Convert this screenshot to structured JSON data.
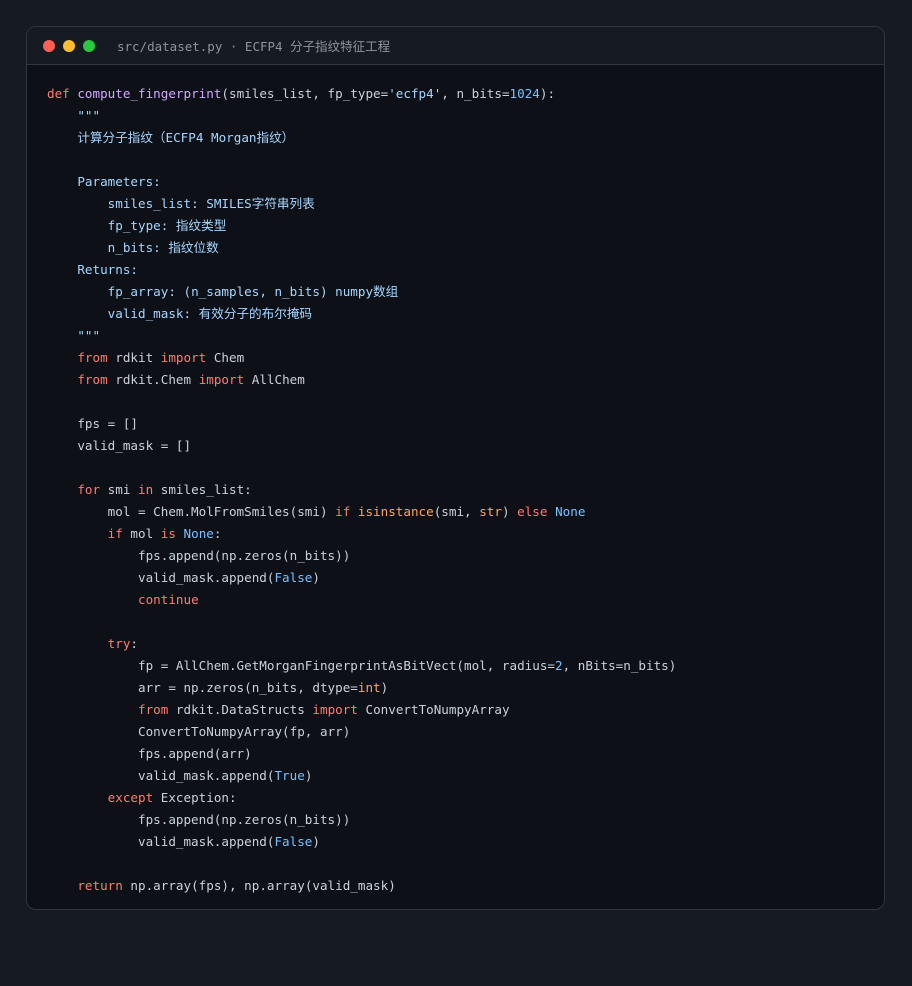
{
  "window": {
    "title": "src/dataset.py · ECFP4 分子指纹特征工程",
    "controls": [
      {
        "name": "close",
        "color": "#ff5f57"
      },
      {
        "name": "minimize",
        "color": "#febc2e"
      },
      {
        "name": "maximize",
        "color": "#28c840"
      }
    ]
  },
  "colors": {
    "keyword": "#ff7b72",
    "function": "#d2a8ff",
    "string": "#a5d6ff",
    "number": "#79c0ff",
    "builtin": "#ffa657",
    "text": "#c9d1d9",
    "background": "#0d1117"
  },
  "code": {
    "lines": [
      [
        [
          "kw",
          "def"
        ],
        [
          "t",
          " "
        ],
        [
          "fn",
          "compute_fingerprint"
        ],
        [
          "t",
          "(smiles_list, fp_type="
        ],
        [
          "str",
          "'ecfp4'"
        ],
        [
          "t",
          ", n_bits="
        ],
        [
          "num",
          "1024"
        ],
        [
          "t",
          "):"
        ]
      ],
      [
        [
          "t",
          "    "
        ],
        [
          "doc",
          "\"\"\""
        ]
      ],
      [
        [
          "t",
          "    "
        ],
        [
          "doc",
          "计算分子指纹（ECFP4 Morgan指纹）"
        ]
      ],
      [],
      [
        [
          "t",
          "    "
        ],
        [
          "doc",
          "Parameters:"
        ]
      ],
      [
        [
          "t",
          "        "
        ],
        [
          "doc",
          "smiles_list: SMILES字符串列表"
        ]
      ],
      [
        [
          "t",
          "        "
        ],
        [
          "doc",
          "fp_type: 指纹类型"
        ]
      ],
      [
        [
          "t",
          "        "
        ],
        [
          "doc",
          "n_bits: 指纹位数"
        ]
      ],
      [
        [
          "t",
          "    "
        ],
        [
          "doc",
          "Returns:"
        ]
      ],
      [
        [
          "t",
          "        "
        ],
        [
          "doc",
          "fp_array: (n_samples, n_bits) numpy数组"
        ]
      ],
      [
        [
          "t",
          "        "
        ],
        [
          "doc",
          "valid_mask: 有效分子的布尔掩码"
        ]
      ],
      [
        [
          "t",
          "    "
        ],
        [
          "doc",
          "\"\"\""
        ]
      ],
      [
        [
          "t",
          "    "
        ],
        [
          "kw",
          "from"
        ],
        [
          "t",
          " rdkit "
        ],
        [
          "kw",
          "import"
        ],
        [
          "t",
          " Chem"
        ]
      ],
      [
        [
          "t",
          "    "
        ],
        [
          "kw",
          "from"
        ],
        [
          "t",
          " rdkit.Chem "
        ],
        [
          "kw",
          "import"
        ],
        [
          "t",
          " AllChem"
        ]
      ],
      [],
      [
        [
          "t",
          "    fps = []"
        ]
      ],
      [
        [
          "t",
          "    valid_mask = []"
        ]
      ],
      [],
      [
        [
          "t",
          "    "
        ],
        [
          "kw",
          "for"
        ],
        [
          "t",
          " smi "
        ],
        [
          "kw",
          "in"
        ],
        [
          "t",
          " smiles_list:"
        ]
      ],
      [
        [
          "t",
          "        mol = Chem.MolFromSmiles(smi) "
        ],
        [
          "kw",
          "if"
        ],
        [
          "t",
          " "
        ],
        [
          "bi",
          "isinstance"
        ],
        [
          "t",
          "(smi, "
        ],
        [
          "bi",
          "str"
        ],
        [
          "t",
          ") "
        ],
        [
          "kw",
          "else"
        ],
        [
          "t",
          " "
        ],
        [
          "const",
          "None"
        ]
      ],
      [
        [
          "t",
          "        "
        ],
        [
          "kw",
          "if"
        ],
        [
          "t",
          " mol "
        ],
        [
          "kw",
          "is"
        ],
        [
          "t",
          " "
        ],
        [
          "const",
          "None"
        ],
        [
          "t",
          ":"
        ]
      ],
      [
        [
          "t",
          "            fps.append(np.zeros(n_bits))"
        ]
      ],
      [
        [
          "t",
          "            valid_mask.append("
        ],
        [
          "const",
          "False"
        ],
        [
          "t",
          ")"
        ]
      ],
      [
        [
          "t",
          "            "
        ],
        [
          "kw",
          "continue"
        ]
      ],
      [],
      [
        [
          "t",
          "        "
        ],
        [
          "kw",
          "try"
        ],
        [
          "t",
          ":"
        ]
      ],
      [
        [
          "t",
          "            fp = AllChem.GetMorganFingerprintAsBitVect(mol, radius="
        ],
        [
          "num",
          "2"
        ],
        [
          "t",
          ", nBits=n_bits)"
        ]
      ],
      [
        [
          "t",
          "            arr = np.zeros(n_bits, dtype="
        ],
        [
          "bi",
          "int"
        ],
        [
          "t",
          ")"
        ]
      ],
      [
        [
          "t",
          "            "
        ],
        [
          "kw",
          "from"
        ],
        [
          "t",
          " rdkit.DataStructs "
        ],
        [
          "kw",
          "import"
        ],
        [
          "t",
          " ConvertToNumpyArray"
        ]
      ],
      [
        [
          "t",
          "            ConvertToNumpyArray(fp, arr)"
        ]
      ],
      [
        [
          "t",
          "            fps.append(arr)"
        ]
      ],
      [
        [
          "t",
          "            valid_mask.append("
        ],
        [
          "const",
          "True"
        ],
        [
          "t",
          ")"
        ]
      ],
      [
        [
          "t",
          "        "
        ],
        [
          "kw",
          "except"
        ],
        [
          "t",
          " Exception:"
        ]
      ],
      [
        [
          "t",
          "            fps.append(np.zeros(n_bits))"
        ]
      ],
      [
        [
          "t",
          "            valid_mask.append("
        ],
        [
          "const",
          "False"
        ],
        [
          "t",
          ")"
        ]
      ],
      [],
      [
        [
          "t",
          "    "
        ],
        [
          "kw",
          "return"
        ],
        [
          "t",
          " np.array(fps), np.array(valid_mask)"
        ]
      ]
    ]
  }
}
